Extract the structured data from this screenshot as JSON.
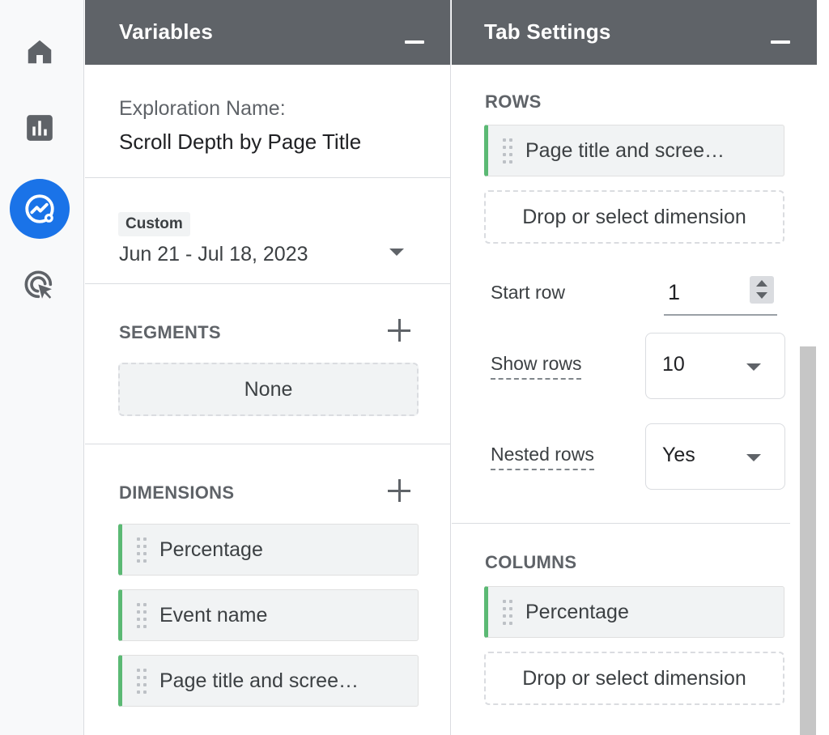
{
  "nav": {
    "items": [
      {
        "icon": "home-icon",
        "label": "Home"
      },
      {
        "icon": "reports-icon",
        "label": "Reports"
      },
      {
        "icon": "explore-icon",
        "label": "Explore",
        "active": true
      },
      {
        "icon": "advertising-icon",
        "label": "Advertising"
      }
    ]
  },
  "variables": {
    "title": "Variables",
    "exploration_name_label": "Exploration Name:",
    "exploration_name": "Scroll Depth by Page Title",
    "date_badge": "Custom",
    "date_range": "Jun 21 - Jul 18, 2023",
    "segments_label": "SEGMENTS",
    "segments_value": "None",
    "dimensions_label": "DIMENSIONS",
    "dimensions": [
      {
        "label": "Percentage"
      },
      {
        "label": "Event name"
      },
      {
        "label": "Page title and scree…"
      }
    ]
  },
  "tab_settings": {
    "title": "Tab Settings",
    "rows_label": "ROWS",
    "rows_chip": "Page title and scree…",
    "rows_dropzone": "Drop or select dimension",
    "start_row_label": "Start row",
    "start_row_value": "1",
    "show_rows_label": "Show rows",
    "show_rows_value": "10",
    "nested_rows_label": "Nested rows",
    "nested_rows_value": "Yes",
    "columns_label": "COLUMNS",
    "columns_chip": "Percentage",
    "columns_dropzone": "Drop or select dimension"
  },
  "colors": {
    "accent": "#1a73e8",
    "chip_marker": "#5bb974",
    "header_bg": "#5f6368"
  }
}
